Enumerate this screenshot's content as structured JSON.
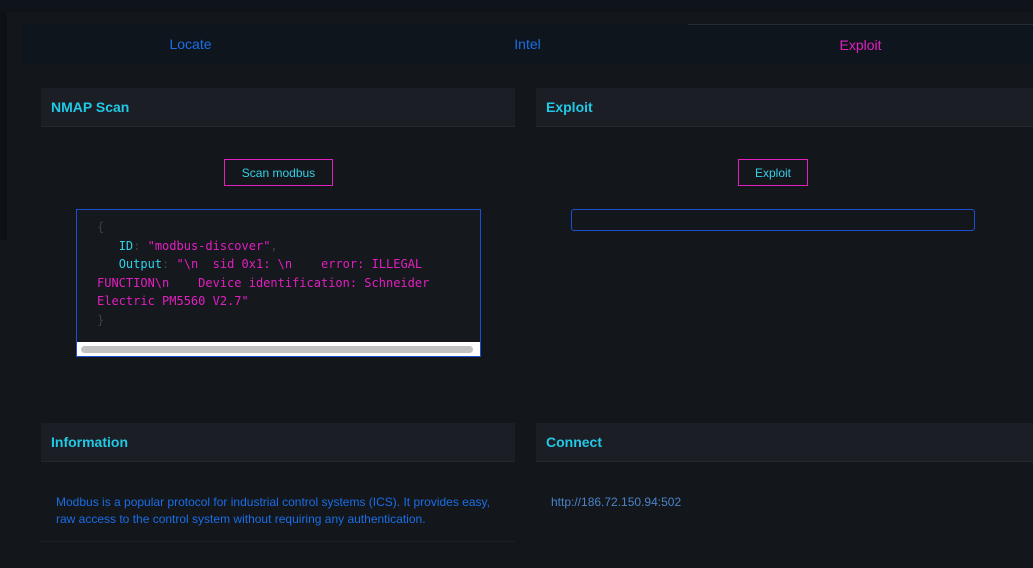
{
  "tabs": {
    "locate": "Locate",
    "intel": "Intel",
    "exploit": "Exploit"
  },
  "nmap": {
    "title": "NMAP Scan",
    "button": "Scan modbus",
    "output": {
      "open_brace": "{",
      "id_key": "ID",
      "id_value": "\"modbus-discover\"",
      "output_key": "Output",
      "output_value": "\"\\n  sid 0x1: \\n    error: ILLEGAL FUNCTION\\n    Device identification: Schneider Electric PM5560 V2.7\"",
      "close_brace": "}"
    }
  },
  "exploit": {
    "title": "Exploit",
    "button": "Exploit",
    "input_value": ""
  },
  "information": {
    "title": "Information",
    "text": "Modbus is a popular protocol for industrial control systems (ICS). It provides easy, raw access to the control system without requiring any authentication."
  },
  "connect": {
    "title": "Connect",
    "url": "http://186.72.150.94:502"
  }
}
